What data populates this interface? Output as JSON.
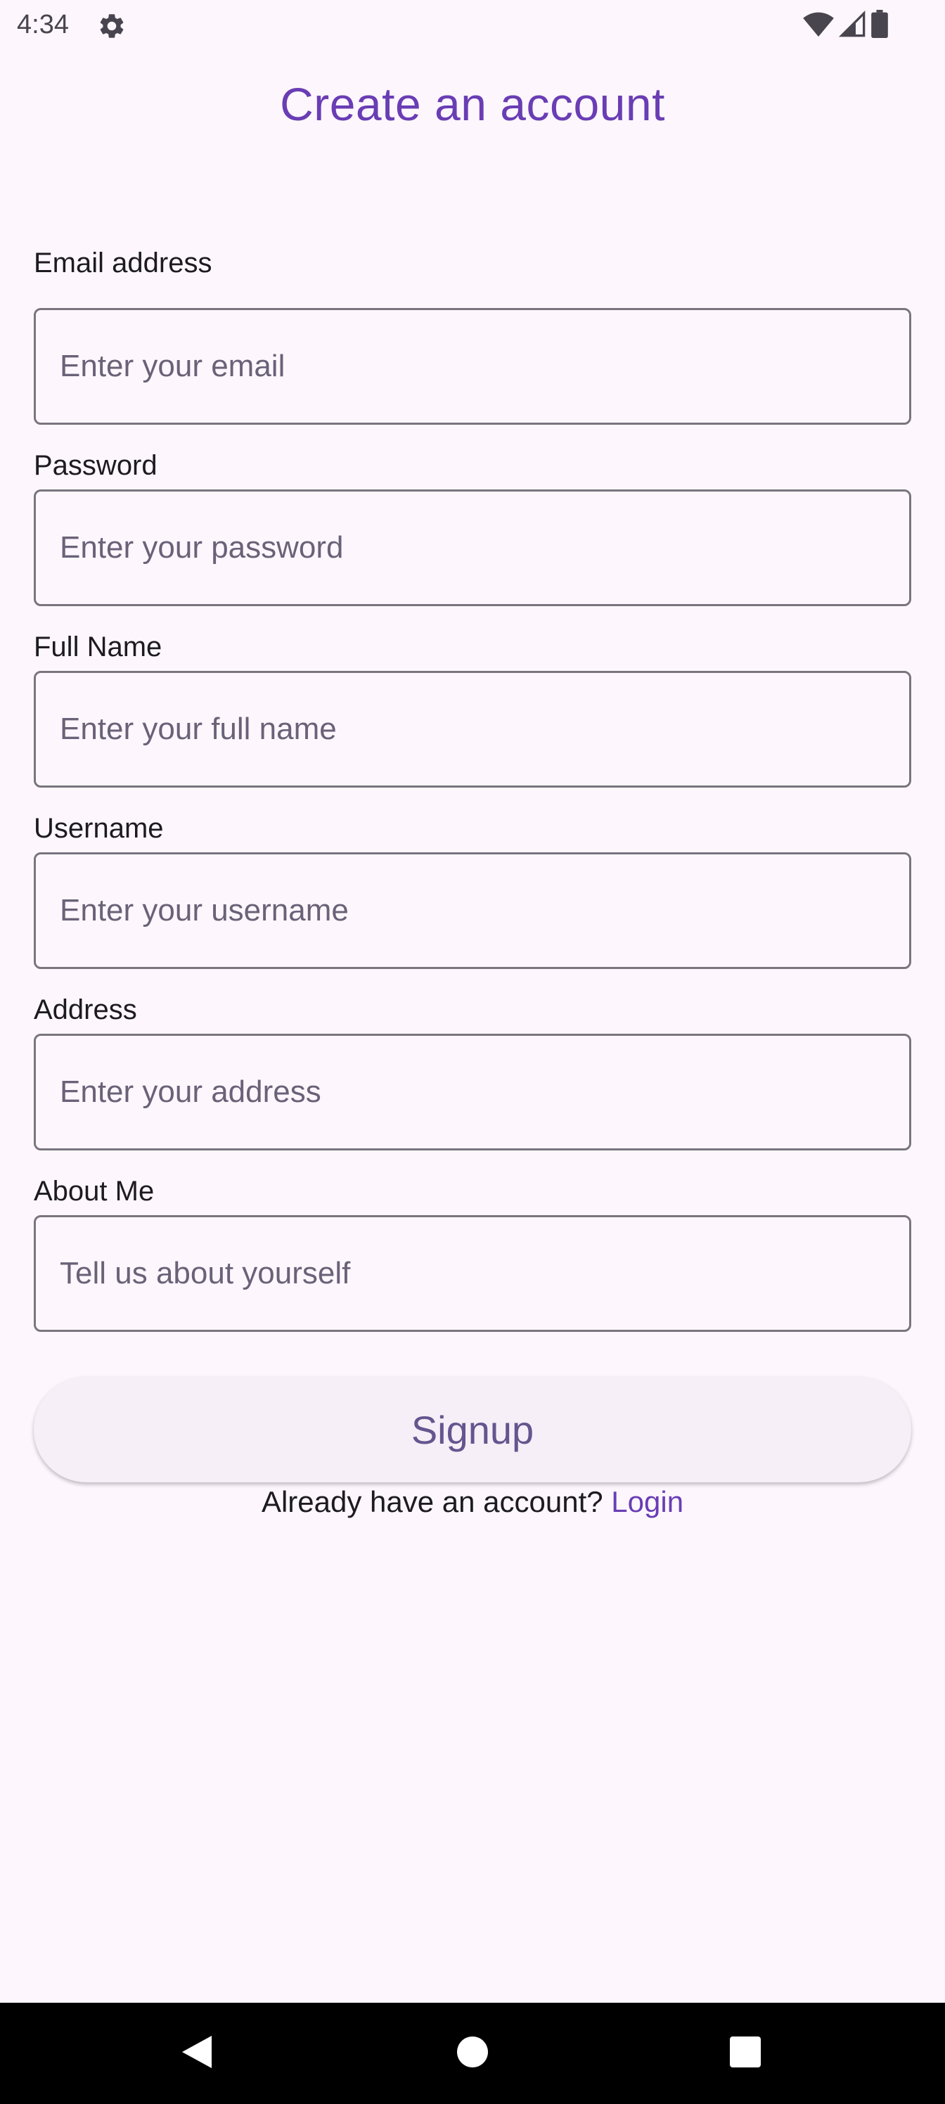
{
  "status_bar": {
    "time": "4:34",
    "icons": [
      "settings-icon",
      "wifi-icon",
      "signal-icon",
      "battery-icon"
    ]
  },
  "title": "Create an account",
  "fields": [
    {
      "label": "Email address",
      "placeholder": "Enter your email",
      "value": ""
    },
    {
      "label": "Password",
      "placeholder": "Enter your password",
      "value": ""
    },
    {
      "label": "Full Name",
      "placeholder": "Enter your full name",
      "value": ""
    },
    {
      "label": "Username",
      "placeholder": "Enter your username",
      "value": ""
    },
    {
      "label": "Address",
      "placeholder": "Enter your address",
      "value": ""
    },
    {
      "label": "About Me",
      "placeholder": "Tell us about yourself",
      "value": ""
    }
  ],
  "signup_label": "Signup",
  "login_prompt": "Already have an account?",
  "login_label": "Login",
  "nav": {
    "icons": [
      "back-icon",
      "home-icon",
      "recents-icon"
    ]
  },
  "colors": {
    "accent": "#6a3db4",
    "button_text": "#65558f",
    "background": "#fdf7fd",
    "outline": "#79747e"
  }
}
